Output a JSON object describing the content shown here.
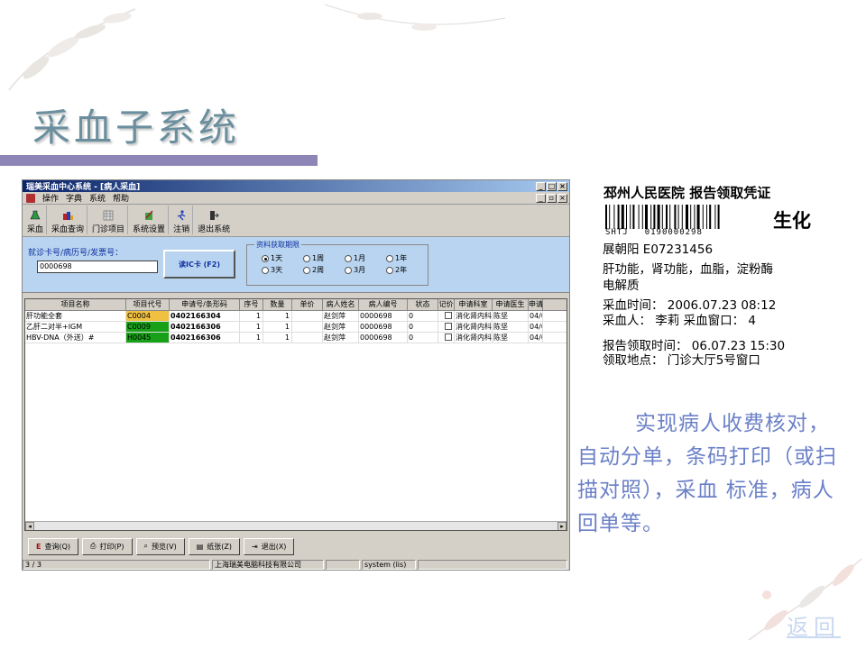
{
  "slide": {
    "title": "采血子系统",
    "description": "实现病人收费核对，自动分单，条码打印（或扫描对照），采血 标准，病人回单等。",
    "back_link": "返回"
  },
  "app": {
    "window_title": "瑞美采血中心系统 - [病人采血]",
    "menu": [
      "操作",
      "字典",
      "系统",
      "帮助"
    ],
    "toolbar": [
      {
        "label": "采血",
        "icon": "flask-icon"
      },
      {
        "label": "采血查询",
        "icon": "query-icon"
      },
      {
        "label": "门诊项目",
        "icon": "grid-icon"
      },
      {
        "label": "系统设置",
        "icon": "settings-icon"
      },
      {
        "label": "注销",
        "icon": "runner-icon"
      },
      {
        "label": "退出系统",
        "icon": "exit-icon"
      }
    ],
    "form": {
      "id_label": "就诊卡号/病历号/发票号：",
      "id_value": "0000698",
      "ic_button": "读IC卡 (F2)",
      "period_label": "资料获取期限",
      "period_options": [
        "1天",
        "1周",
        "1月",
        "1年",
        "3天",
        "2周",
        "3月",
        "2年"
      ],
      "period_selected": "1天"
    },
    "grid": {
      "headers": [
        "项目名称",
        "项目代号",
        "申请号/条形码",
        "序号",
        "数量",
        "单价",
        "病人姓名",
        "病人编号",
        "状态",
        "记价",
        "申请科室",
        "申请医生",
        "申请"
      ],
      "rows": [
        {
          "name": "肝功能全套",
          "code": "C0004",
          "code_color": "#f0c040",
          "barcode": "0402166304",
          "seq": "1",
          "qty": "1",
          "price": "",
          "patient": "赵剑萍",
          "patient_id": "0000698",
          "status": "0",
          "dept": "消化肾内科",
          "doctor": "陈坚",
          "date": "04/0"
        },
        {
          "name": "乙肝二对半+IGM",
          "code": "C0009",
          "code_color": "#18a018",
          "barcode": "0402166306",
          "seq": "1",
          "qty": "1",
          "price": "",
          "patient": "赵剑萍",
          "patient_id": "0000698",
          "status": "0",
          "dept": "消化肾内科",
          "doctor": "陈坚",
          "date": "04/0"
        },
        {
          "name": "HBV-DNA（外送）#",
          "code": "H0045",
          "code_color": "#18a018",
          "barcode": "0402166306",
          "seq": "1",
          "qty": "1",
          "price": "",
          "patient": "赵剑萍",
          "patient_id": "0000698",
          "status": "0",
          "dept": "消化肾内科",
          "doctor": "陈坚",
          "date": "04/0"
        }
      ]
    },
    "buttons": [
      {
        "label": "查询(Q)",
        "icon": "query-icon"
      },
      {
        "label": "打印(P)",
        "icon": "printer-icon"
      },
      {
        "label": "预览(V)",
        "icon": "preview-icon"
      },
      {
        "label": "纸张(Z)",
        "icon": "paper-icon"
      },
      {
        "label": "退出(X)",
        "icon": "exit-icon"
      }
    ],
    "status": {
      "page": "3 / 3",
      "company": "上海瑞美电脑科技有限公司",
      "user": "system (lis)"
    }
  },
  "ticket": {
    "header": "邳州人民医院 报告领取凭证",
    "barcode_left": "SHTJ",
    "barcode_number": "0190000298",
    "category": "生化",
    "patient_line": "展朝阳 E07231456",
    "items_line1": "肝功能，肾功能，血脂，淀粉酶",
    "items_line2": "电解质",
    "draw_time": "采血时间： 2006.07.23 08:12",
    "drawer": "采血人： 李莉   采血窗口： 4",
    "report_time": "报告领取时间： 06.07.23 15:30",
    "location": "领取地点： 门诊大厅5号窗口"
  }
}
